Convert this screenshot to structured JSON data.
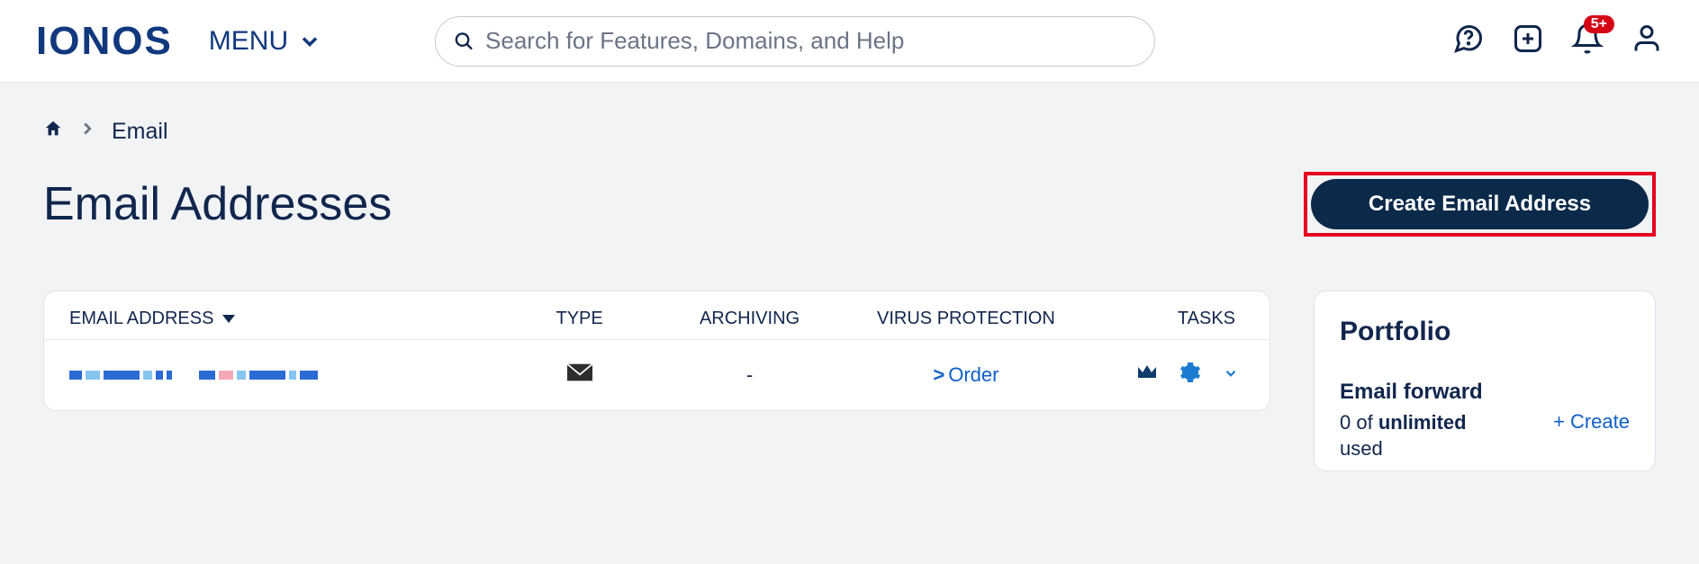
{
  "header": {
    "logo": "IONOS",
    "menu_label": "MENU",
    "search_placeholder": "Search for Features, Domains, and Help",
    "notification_badge": "5+"
  },
  "breadcrumb": {
    "current": "Email"
  },
  "page": {
    "title": "Email Addresses",
    "create_button": "Create Email Address"
  },
  "table": {
    "columns": {
      "email": "EMAIL ADDRESS",
      "type": "TYPE",
      "archiving": "ARCHIVING",
      "virus": "VIRUS PROTECTION",
      "tasks": "TASKS"
    },
    "rows": [
      {
        "archiving": "-",
        "virus_label": "Order"
      }
    ]
  },
  "portfolio": {
    "title": "Portfolio",
    "forward_title": "Email forward",
    "forward_pre": "0 of ",
    "forward_bold": "unlimited",
    "forward_post": "used",
    "create_label": "Create"
  }
}
